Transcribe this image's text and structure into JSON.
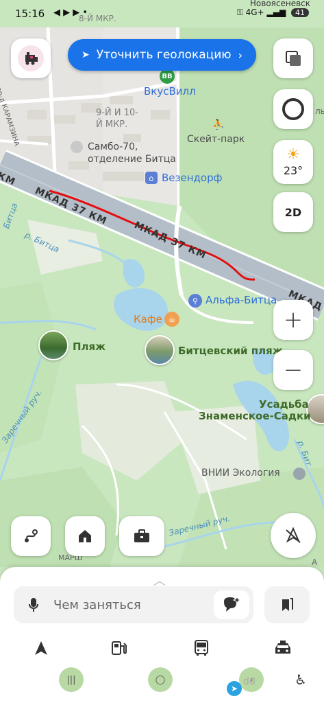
{
  "status_bar": {
    "time": "15:16",
    "app_icons": "◀ ▶ ▶ •",
    "top_right_text": "Новоясеневск",
    "network": "4G+",
    "battery": "41"
  },
  "map": {
    "labels": {
      "micro_district_top": "8-Й МКР.",
      "micro_district": "9-Й И 10-\nЙ МКР.",
      "vkusvill": "ВкусВилл",
      "vkusvill_badge": "ВВ",
      "sambo": "Самбо-70,\nотделение Битца",
      "skatepark": "Скейт-парк",
      "wezendorf": "Везендорф",
      "street_karamzina": "пр-д КАРАМЗИНА",
      "mkad_left": "КМ",
      "mkad_1": "МКАД 37 КМ",
      "mkad_2": "МКАД 37 КМ",
      "mkad_right": "МКАД",
      "river_bitsa_1": "р. Битца",
      "river_bitsa_2": "Битца",
      "river_bitsa_right": "р. Бит",
      "alfa_bitsa": "Альфа-Битца",
      "cafe": "Кафе",
      "beach": "Пляж",
      "bitsa_beach": "Битцевский пляж",
      "usadba_1": "Усадьба",
      "usadba_2": "Знаменское-Садки",
      "zarechny_1": "Заречный руч.",
      "zarechny_2": "Заречный руч.",
      "vnii": "ВНИИ Экология",
      "marsh": "МАРШ",
      "letter_a": "А",
      "right_edge": "ль"
    }
  },
  "controls": {
    "geolocation_button": "Уточнить геолокацию",
    "weather_temp": "23°",
    "view_mode": "2D",
    "zoom_in": "+",
    "zoom_out": "−"
  },
  "bottom_sheet": {
    "search_placeholder": "Чем заняться",
    "modes": [
      "drive",
      "fuel",
      "transit",
      "taxi"
    ]
  },
  "icons": {
    "profile": "train-avatar-icon",
    "layers": "layers-icon",
    "alice": "alice-icon",
    "route": "route-icon",
    "home": "home-icon",
    "work": "briefcase-icon",
    "compass": "location-off-icon"
  },
  "colors": {
    "accent": "#1a73e8",
    "route_red": "#e01010",
    "park_green": "#c8e6bd",
    "water": "#a8d4ec",
    "road": "#b4bec8"
  },
  "watermark": "dd"
}
